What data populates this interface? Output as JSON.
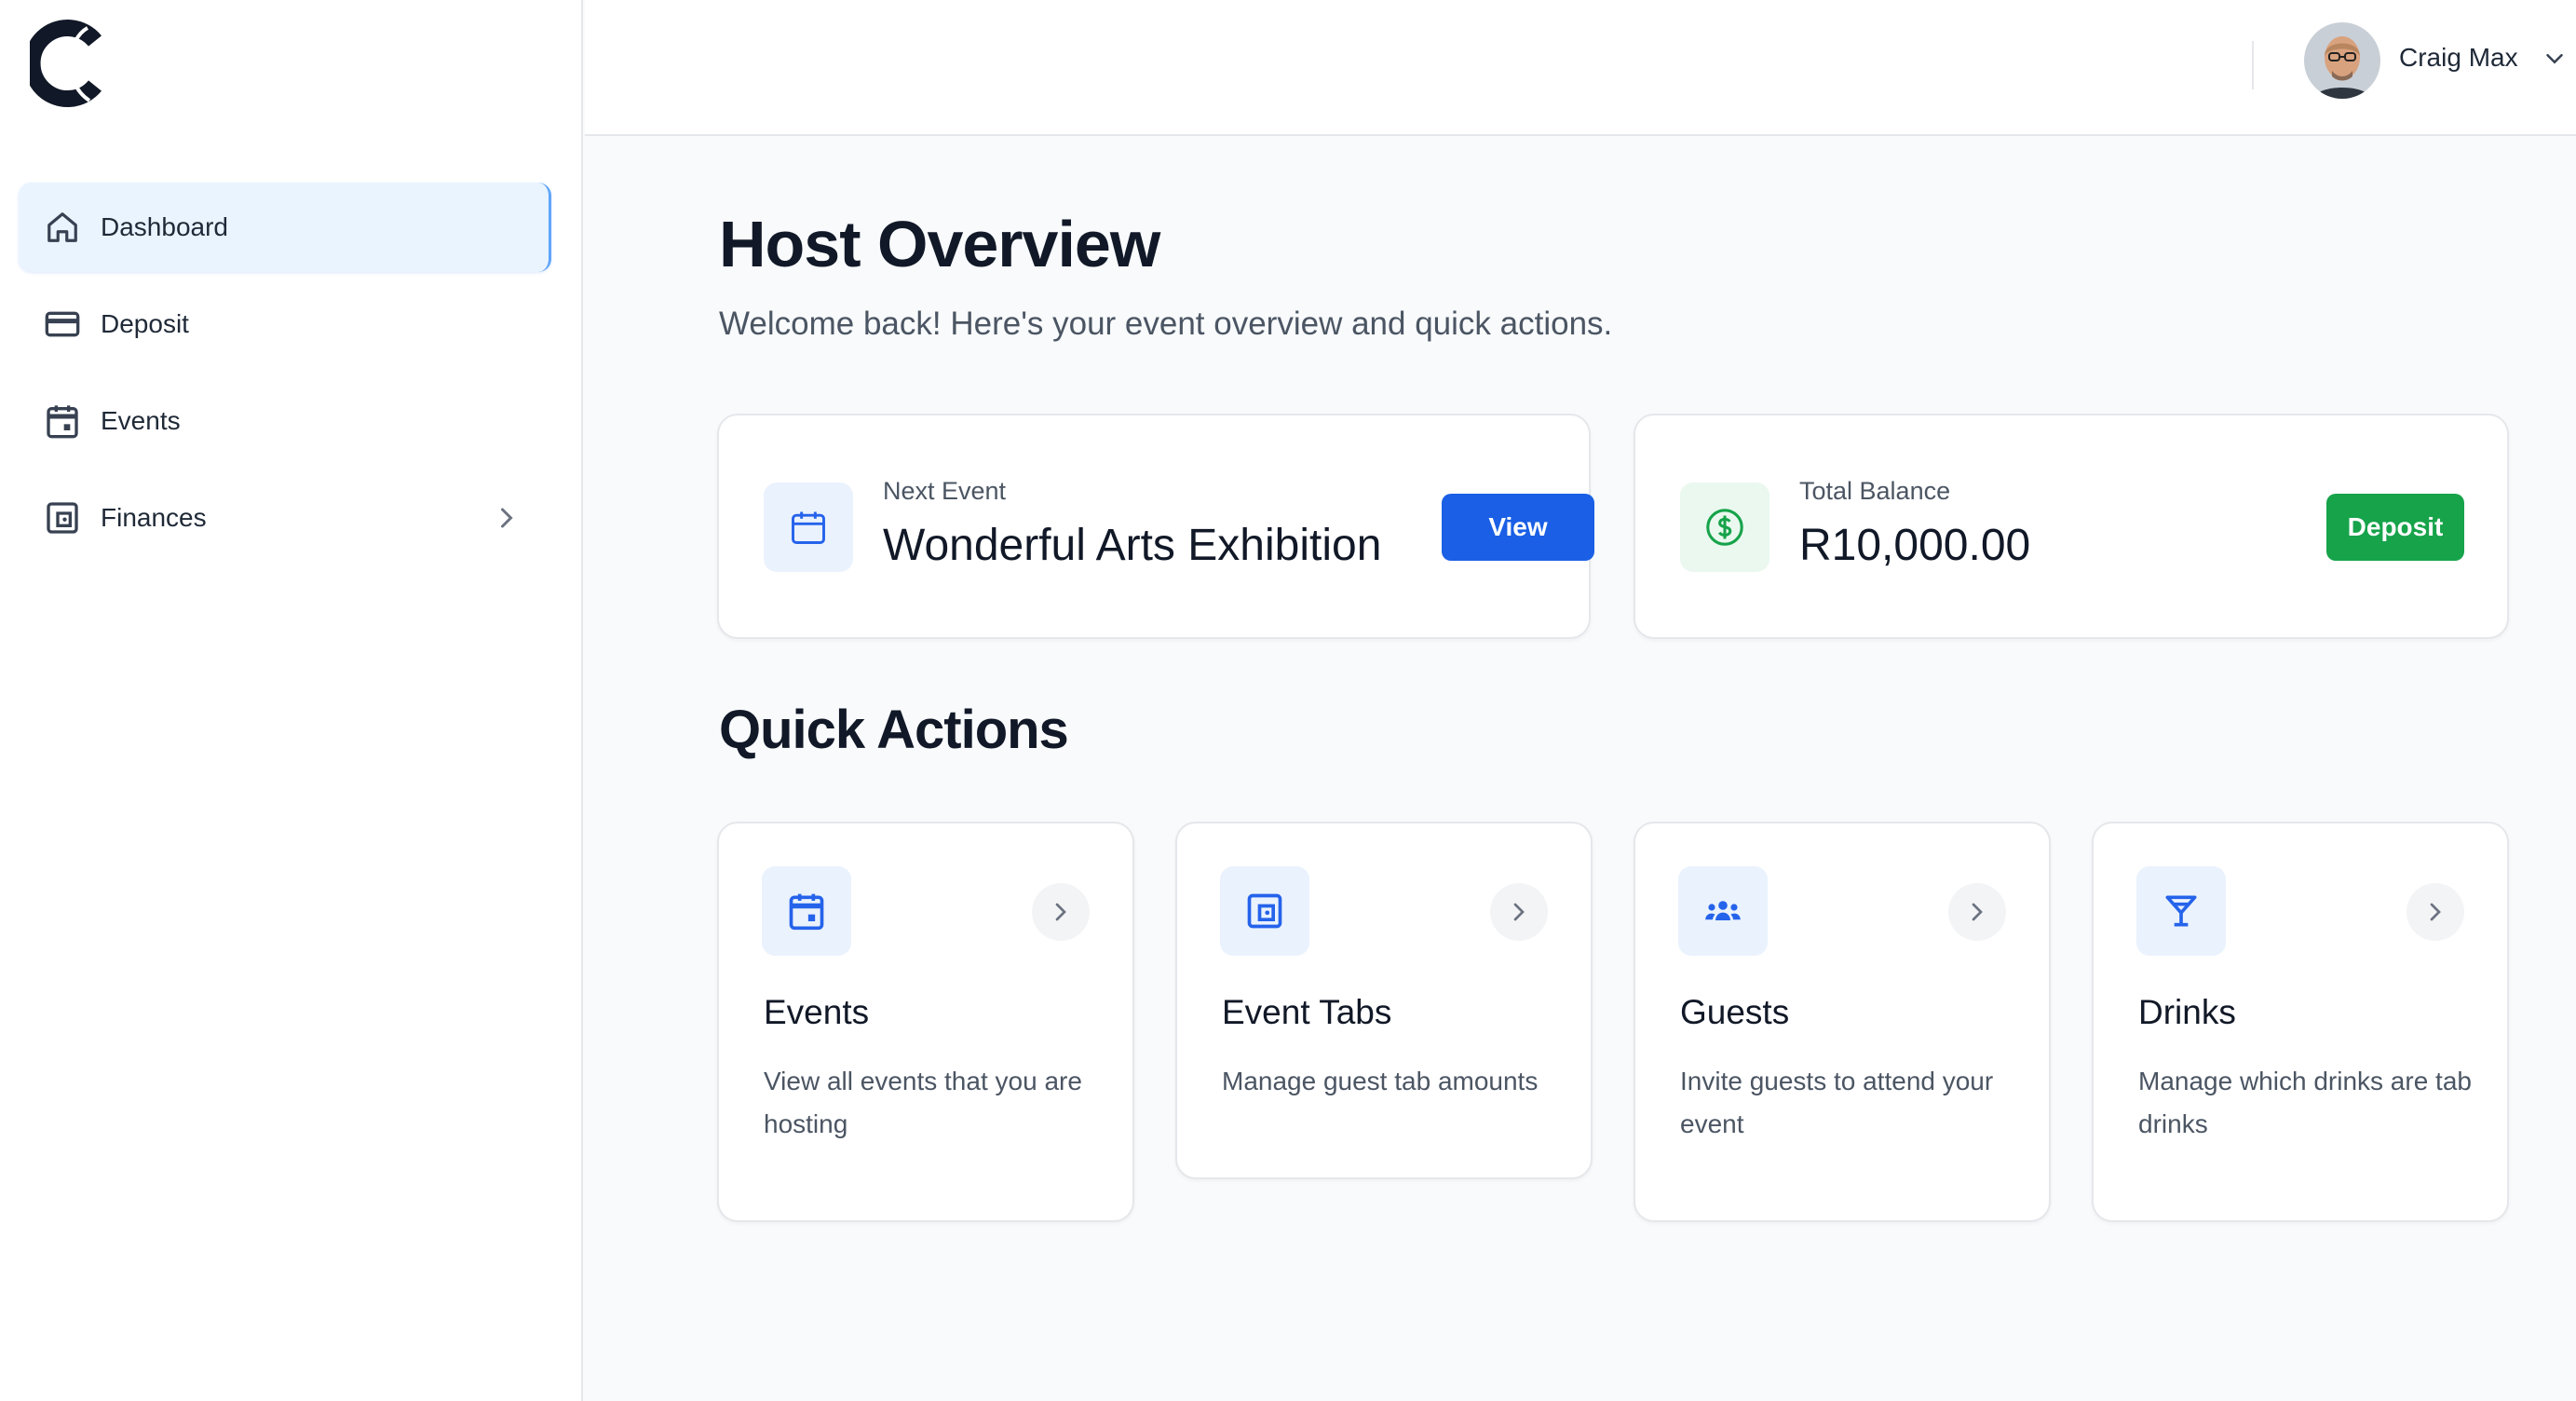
{
  "brand": {
    "logo": "c-logo-icon"
  },
  "sidebar": {
    "items": [
      {
        "label": "Dashboard",
        "icon": "home-icon",
        "active": true
      },
      {
        "label": "Deposit",
        "icon": "credit-card-icon"
      },
      {
        "label": "Events",
        "icon": "calendar-icon"
      },
      {
        "label": "Finances",
        "icon": "wallet-icon",
        "has_submenu": true
      }
    ]
  },
  "header": {
    "user_name": "Craig Max"
  },
  "main": {
    "title": "Host Overview",
    "subtitle": "Welcome back! Here's your event overview and quick actions.",
    "next_event": {
      "label": "Next Event",
      "value": "Wonderful Arts Exhibition",
      "button": "View"
    },
    "balance": {
      "label": "Total Balance",
      "value": "R10,000.00",
      "button": "Deposit"
    },
    "quick_actions_title": "Quick Actions",
    "quick_actions": [
      {
        "title": "Events",
        "description": "View all events that you are hosting",
        "icon": "calendar-icon"
      },
      {
        "title": "Event Tabs",
        "description": "Manage guest tab amounts",
        "icon": "wallet-icon"
      },
      {
        "title": "Guests",
        "description": "Invite guests to attend your event",
        "icon": "users-icon"
      },
      {
        "title": "Drinks",
        "description": "Manage which drinks are tab drinks",
        "icon": "cocktail-icon"
      }
    ]
  },
  "colors": {
    "primary": "#1a5fe5",
    "success": "#16a34a",
    "active_nav_bg": "#eaf4fe"
  }
}
